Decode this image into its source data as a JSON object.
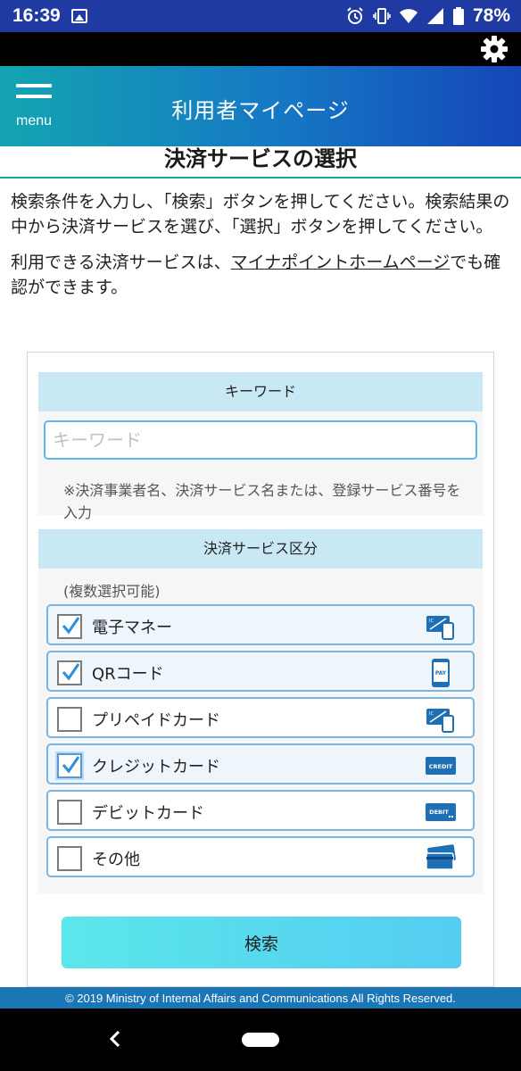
{
  "status_bar": {
    "time": "16:39",
    "battery": "78%",
    "icons": [
      "image-icon",
      "alarm-icon",
      "vibrate-icon",
      "wifi-icon",
      "signal-icon",
      "battery-icon"
    ]
  },
  "header": {
    "menu_label": "menu",
    "title": "利用者マイページ",
    "colors": {
      "gradient_start": "#14a4b1",
      "gradient_end": "#1546b8"
    }
  },
  "page": {
    "title": "決済サービスの選択",
    "intro_line": "検索条件を入力し、「検索」ボタンを押してください。検索結果の中から決済サービスを選び、「選択」ボタンを押してください。",
    "intro2_prefix": "利用できる決済サービスは、",
    "intro2_link": "マイナポイントホームページ",
    "intro2_suffix": "でも確認ができます。"
  },
  "keyword": {
    "heading": "キーワード",
    "placeholder": "キーワード",
    "value": "",
    "note": "※決済事業者名、決済サービス名または、登録サービス番号を入力"
  },
  "service_type": {
    "heading": "決済サービス区分",
    "multi_note": "(複数選択可能)",
    "options": [
      {
        "label": "電子マネー",
        "checked": true,
        "icon": "ic-card-icon"
      },
      {
        "label": "QRコード",
        "checked": true,
        "icon": "pay-phone-icon"
      },
      {
        "label": "プリペイドカード",
        "checked": false,
        "icon": "ic-card-icon"
      },
      {
        "label": "クレジットカード",
        "checked": true,
        "icon": "credit-card-icon"
      },
      {
        "label": "デビットカード",
        "checked": false,
        "icon": "debit-card-icon"
      },
      {
        "label": "その他",
        "checked": false,
        "icon": "cards-icon"
      }
    ],
    "icon_texts": {
      "ic": "IC",
      "pay": "PAY",
      "credit": "CREDIT",
      "debit": "DEBIT"
    }
  },
  "search_button": {
    "label": "検索"
  },
  "footer": {
    "copyright": "© 2019 Ministry of Internal Affairs and Communications All Rights Reserved."
  }
}
